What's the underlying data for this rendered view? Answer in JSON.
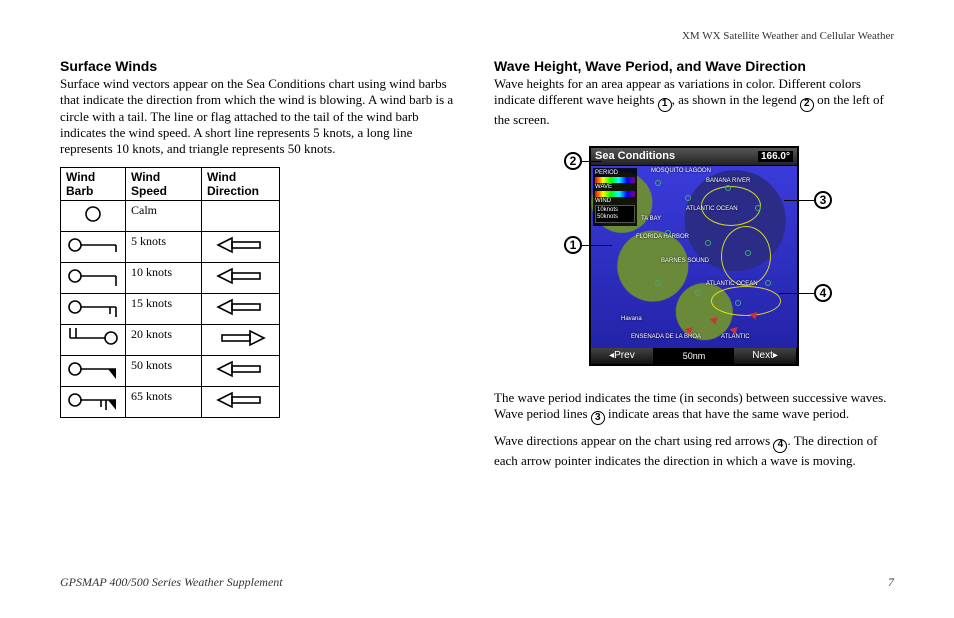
{
  "header": {
    "section_title": "XM WX Satellite Weather and Cellular Weather"
  },
  "left": {
    "heading": "Surface Winds",
    "para1": "Surface wind vectors appear on the Sea Conditions chart using wind barbs that indicate the direction from which the wind is blowing. A wind barb is a circle with a tail. The line or flag attached to the tail of the wind barb indicates the wind speed. A short line represents 5 knots, a long line represents 10 knots, and triangle represents 50 knots.",
    "table": {
      "headers": [
        "Wind Barb",
        "Wind Speed",
        "Wind Direction"
      ],
      "rows": [
        {
          "speed": "Calm",
          "barb": "calm",
          "dir": "none"
        },
        {
          "speed": "5 knots",
          "barb": "k5",
          "dir": "left"
        },
        {
          "speed": "10 knots",
          "barb": "k10",
          "dir": "left"
        },
        {
          "speed": "15 knots",
          "barb": "k15",
          "dir": "left"
        },
        {
          "speed": "20 knots",
          "barb": "k20",
          "dir": "right"
        },
        {
          "speed": "50 knots",
          "barb": "k50",
          "dir": "left"
        },
        {
          "speed": "65 knots",
          "barb": "k65",
          "dir": "left"
        }
      ]
    }
  },
  "right": {
    "heading": "Wave Height, Wave Period, and Wave Direction",
    "para1a": "Wave heights for an area appear as variations in color. Different colors indicate different wave heights ",
    "para1b": ", as shown in the legend ",
    "para1c": " on the left of the screen.",
    "para2a": "The wave period indicates the time (in seconds) between successive waves. Wave period lines ",
    "para2b": " indicate areas that have the same wave period.",
    "para3a": "Wave directions appear on the chart using red arrows ",
    "para3b": ". The direction of each arrow pointer indicates the direction in which a wave is moving.",
    "device": {
      "title": "Sea Conditions",
      "value": "166.0°",
      "legend": {
        "period_label": "PERIOD",
        "wave_label": "WAVE",
        "wind_label": "WIND",
        "wind_items": [
          "10knots",
          "50knots"
        ]
      },
      "map_labels": [
        "MOSQUITO LAGOON",
        "BANANA RIVER",
        "ATLANTIC OCEAN",
        "TA BAY",
        "BARNES SOUND",
        "FLORIDA HARBOR",
        "ATLANTIC OCEAN",
        "Havana",
        "ENSENADA DE LA BROA",
        "ATLANTIC"
      ],
      "scale": "50nm",
      "prev": "Prev",
      "next": "Next"
    },
    "callouts": {
      "c1": "1",
      "c2": "2",
      "c3": "3",
      "c4": "4"
    }
  },
  "footer": {
    "left": "GPSMAP 400/500 Series Weather Supplement",
    "page": "7"
  },
  "circled": {
    "n1": "1",
    "n2": "2",
    "n3": "3",
    "n4": "4"
  }
}
